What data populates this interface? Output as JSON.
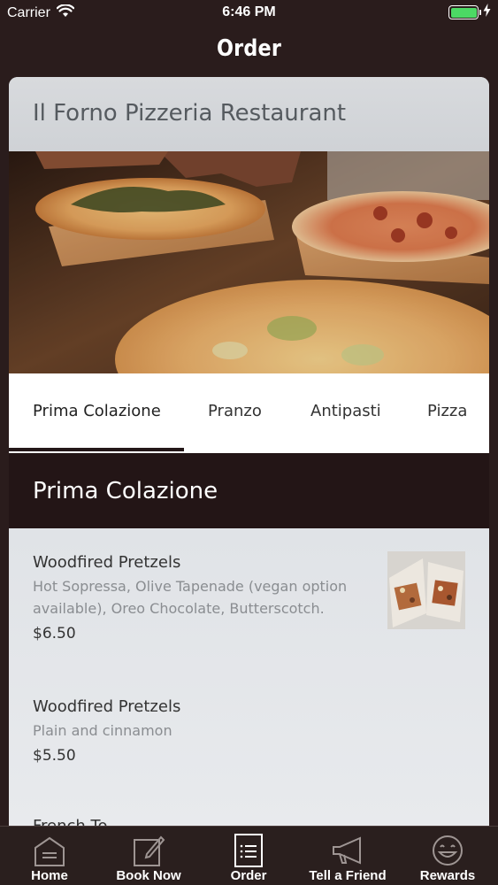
{
  "status_bar": {
    "carrier": "Carrier",
    "time": "6:46 PM",
    "battery_color": "#4cd964"
  },
  "nav": {
    "title": "Order"
  },
  "restaurant": {
    "name": "Il Forno Pizzeria Restaurant"
  },
  "tabs": [
    {
      "label": "Prima Colazione",
      "active": true
    },
    {
      "label": "Pranzo",
      "active": false
    },
    {
      "label": "Antipasti",
      "active": false
    },
    {
      "label": "Pizza",
      "active": false
    }
  ],
  "section": {
    "title": "Prima Colazione"
  },
  "menu_items": [
    {
      "name": "Woodfired Pretzels",
      "description": "Hot Sopressa, Olive Tapenade (vegan option available), Oreo Chocolate, Butterscotch.",
      "price": "$6.50",
      "has_image": true
    },
    {
      "name": "Woodfired Pretzels",
      "description": "Plain and cinnamon",
      "price": "$5.50",
      "has_image": false
    },
    {
      "name": "French To",
      "partial": true
    }
  ],
  "tab_bar": {
    "items": [
      {
        "label": "Home",
        "icon": "home-icon"
      },
      {
        "label": "Book Now",
        "icon": "edit-icon"
      },
      {
        "label": "Order",
        "icon": "menu-list-icon"
      },
      {
        "label": "Tell a Friend",
        "icon": "megaphone-icon"
      },
      {
        "label": "Rewards",
        "icon": "smile-icon"
      }
    ]
  },
  "colors": {
    "nav_background": "#2a1c1c",
    "section_header": "#231516",
    "tab_bar": "#2a1f1e"
  }
}
